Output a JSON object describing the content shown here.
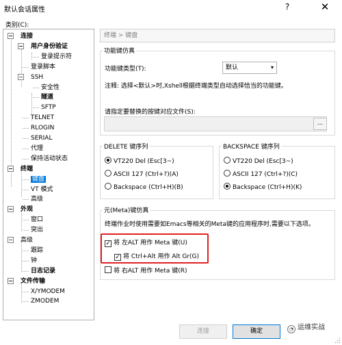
{
  "window": {
    "title": "默认会话属性",
    "help_glyph": "?",
    "close_glyph": "✕"
  },
  "category_label": "类别(C):",
  "tree": [
    {
      "label": "连接",
      "bold": true,
      "toggle": "−"
    },
    {
      "label": "用户身份验证",
      "bold": true,
      "toggle": "−"
    },
    {
      "label": "登录提示符"
    },
    {
      "label": "登录脚本"
    },
    {
      "label": "SSH",
      "toggle": "−"
    },
    {
      "label": "安全性"
    },
    {
      "label": "隧道",
      "bold": true
    },
    {
      "label": "SFTP"
    },
    {
      "label": "TELNET"
    },
    {
      "label": "RLOGIN"
    },
    {
      "label": "SERIAL"
    },
    {
      "label": "代理"
    },
    {
      "label": "保持活动状态"
    },
    {
      "label": "终端",
      "bold": true,
      "toggle": "−"
    },
    {
      "label": "键盘",
      "selected": true
    },
    {
      "label": "VT 模式"
    },
    {
      "label": "高级"
    },
    {
      "label": "外观",
      "bold": true,
      "toggle": "−"
    },
    {
      "label": "窗口"
    },
    {
      "label": "突出"
    },
    {
      "label": "高级",
      "toggle": "−"
    },
    {
      "label": "跟踪"
    },
    {
      "label": "钟"
    },
    {
      "label": "日志记录",
      "bold": true
    },
    {
      "label": "文件传输",
      "bold": true,
      "toggle": "−"
    },
    {
      "label": "X/YMODEM"
    },
    {
      "label": "ZMODEM"
    }
  ],
  "breadcrumb": "终端 > 键盘",
  "function_keys": {
    "legend": "功能键仿真",
    "type_label": "功能键类型(T):",
    "type_value": "默认",
    "note": "注释: 选择<默认>时,Xshell根据终端类型自动选择恰当的功能键。",
    "file_label": "请指定要替换的按键对应文件(S):",
    "file_value": "",
    "browse_label": "..."
  },
  "delete_group": {
    "legend": "DELETE 键序列",
    "options": [
      {
        "label": "VT220 Del (Esc[3~)",
        "checked": true
      },
      {
        "label": "ASCII 127 (Ctrl+?)(A)",
        "checked": false
      },
      {
        "label": "Backspace (Ctrl+H)(B)",
        "checked": false
      }
    ]
  },
  "backspace_group": {
    "legend": "BACKSPACE 键序列",
    "options": [
      {
        "label": "VT220 Del (Esc[3~)",
        "checked": false
      },
      {
        "label": "ASCII 127 (Ctrl+?)(C)",
        "checked": false
      },
      {
        "label": "Backspace (Ctrl+H)(K)",
        "checked": true
      }
    ]
  },
  "meta": {
    "legend": "元(Meta)键仿真",
    "description": "终端作业时使用需要如Emacs等相关的Meta键的应用程序时,需要以下选项。",
    "left_alt": {
      "label": "将 左ALT 用作 Meta 键(U)",
      "checked": true
    },
    "ctrl_alt": {
      "label": "将 Ctrl+Alt 用作 Alt Gr(G)",
      "checked": true
    },
    "right_alt": {
      "label": "将 右ALT 用作 Meta 键(R)",
      "checked": false
    }
  },
  "buttons": {
    "connect": "连接",
    "ok": "确定"
  },
  "watermark": "运维实战",
  "check_glyph": "✓"
}
